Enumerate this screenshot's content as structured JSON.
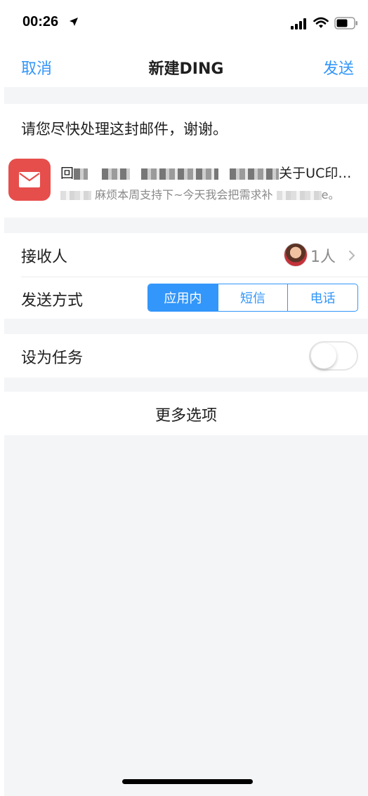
{
  "status_bar": {
    "time": "00:26"
  },
  "nav": {
    "cancel_label": "取消",
    "title": "新建DING",
    "send_label": "发送"
  },
  "message": {
    "text": "请您尽快处理这封邮件，谢谢。",
    "mail_subject_prefix": "回",
    "mail_subject_suffix": "关于UC印…",
    "mail_preview_text": "麻烦本周支持下~今天我会把需求补",
    "mail_preview_end": "e。"
  },
  "settings": {
    "recipient_label": "接收人",
    "recipient_count": "1人",
    "send_method_label": "发送方式",
    "send_methods": [
      "应用内",
      "短信",
      "电话"
    ],
    "selected_method": "应用内",
    "task_label": "设为任务",
    "task_enabled": false,
    "more_options_label": "更多选项"
  },
  "colors": {
    "accent": "#3296fa",
    "mail_icon_bg": "#e64e4c",
    "background": "#f4f5f7"
  }
}
